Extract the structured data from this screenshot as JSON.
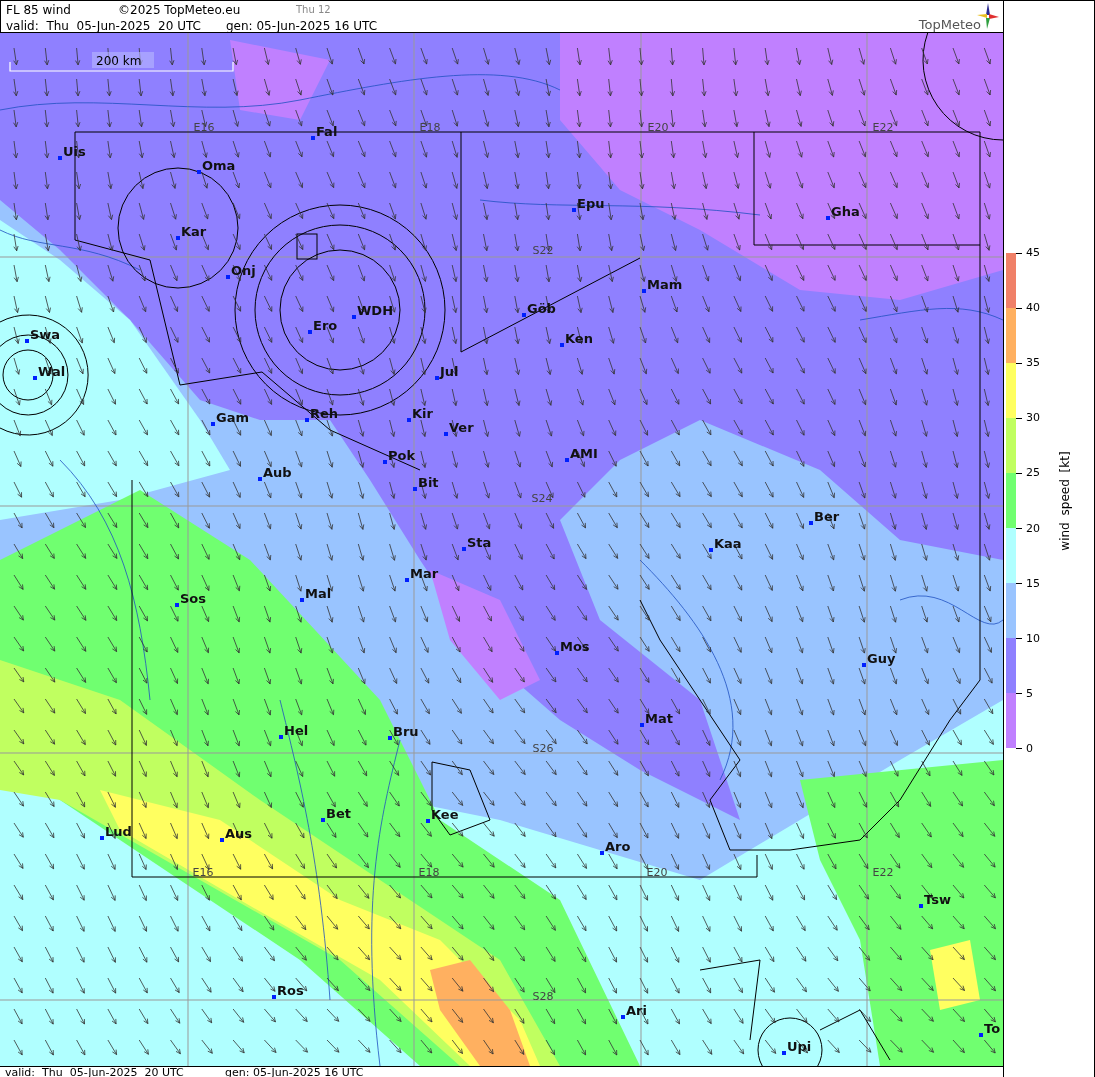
{
  "header": {
    "title": "FL 85 wind",
    "copyright": "©2025 TopMeteo.eu",
    "step": "Thu 12",
    "valid": "valid:  Thu  05-Jun-2025  20 UTC",
    "generated": "gen: 05-Jun-2025 16 UTC",
    "logo": "TopMeteo"
  },
  "map": {
    "scale": "200 km",
    "grid_labels": [
      "E16",
      "E18",
      "E20",
      "E22",
      "S22",
      "S24",
      "S26",
      "E16",
      "E18",
      "E20",
      "E22",
      "S28"
    ],
    "places": [
      "Uis",
      "Oma",
      "Fal",
      "Kar",
      "Onj",
      "Epu",
      "Gha",
      "Mam",
      "Göb",
      "WDH",
      "Ero",
      "Ken",
      "Swa",
      "Wal",
      "Jul",
      "Gam",
      "Reh",
      "Kir",
      "Ver",
      "AMI",
      "Pok",
      "Bit",
      "Aub",
      "Ber",
      "Sta",
      "Kaa",
      "Mar",
      "Sos",
      "Mal",
      "Mos",
      "Guy",
      "Mat",
      "Hel",
      "Bru",
      "Bet",
      "Kee",
      "Aus",
      "Lud",
      "Aro",
      "Tsw",
      "Ros",
      "Ari",
      "Upi",
      "To"
    ]
  },
  "legend": {
    "title": "wind speed [kt]",
    "ticks": [
      "45",
      "40",
      "35",
      "30",
      "25",
      "20",
      "15",
      "10",
      "5",
      "0"
    ],
    "bands": [
      {
        "color": "#f08068"
      },
      {
        "color": "#ffb060"
      },
      {
        "color": "#ffff60"
      },
      {
        "color": "#c0ff60"
      },
      {
        "color": "#70ff70"
      },
      {
        "color": "#b0ffff"
      },
      {
        "color": "#99c4ff"
      },
      {
        "color": "#8f80ff"
      },
      {
        "color": "#c080ff"
      }
    ]
  },
  "footer": {
    "valid": "valid:  Thu  05-Jun-2025  20 UTC",
    "generated": "gen: 05-Jun-2025 16 UTC"
  }
}
